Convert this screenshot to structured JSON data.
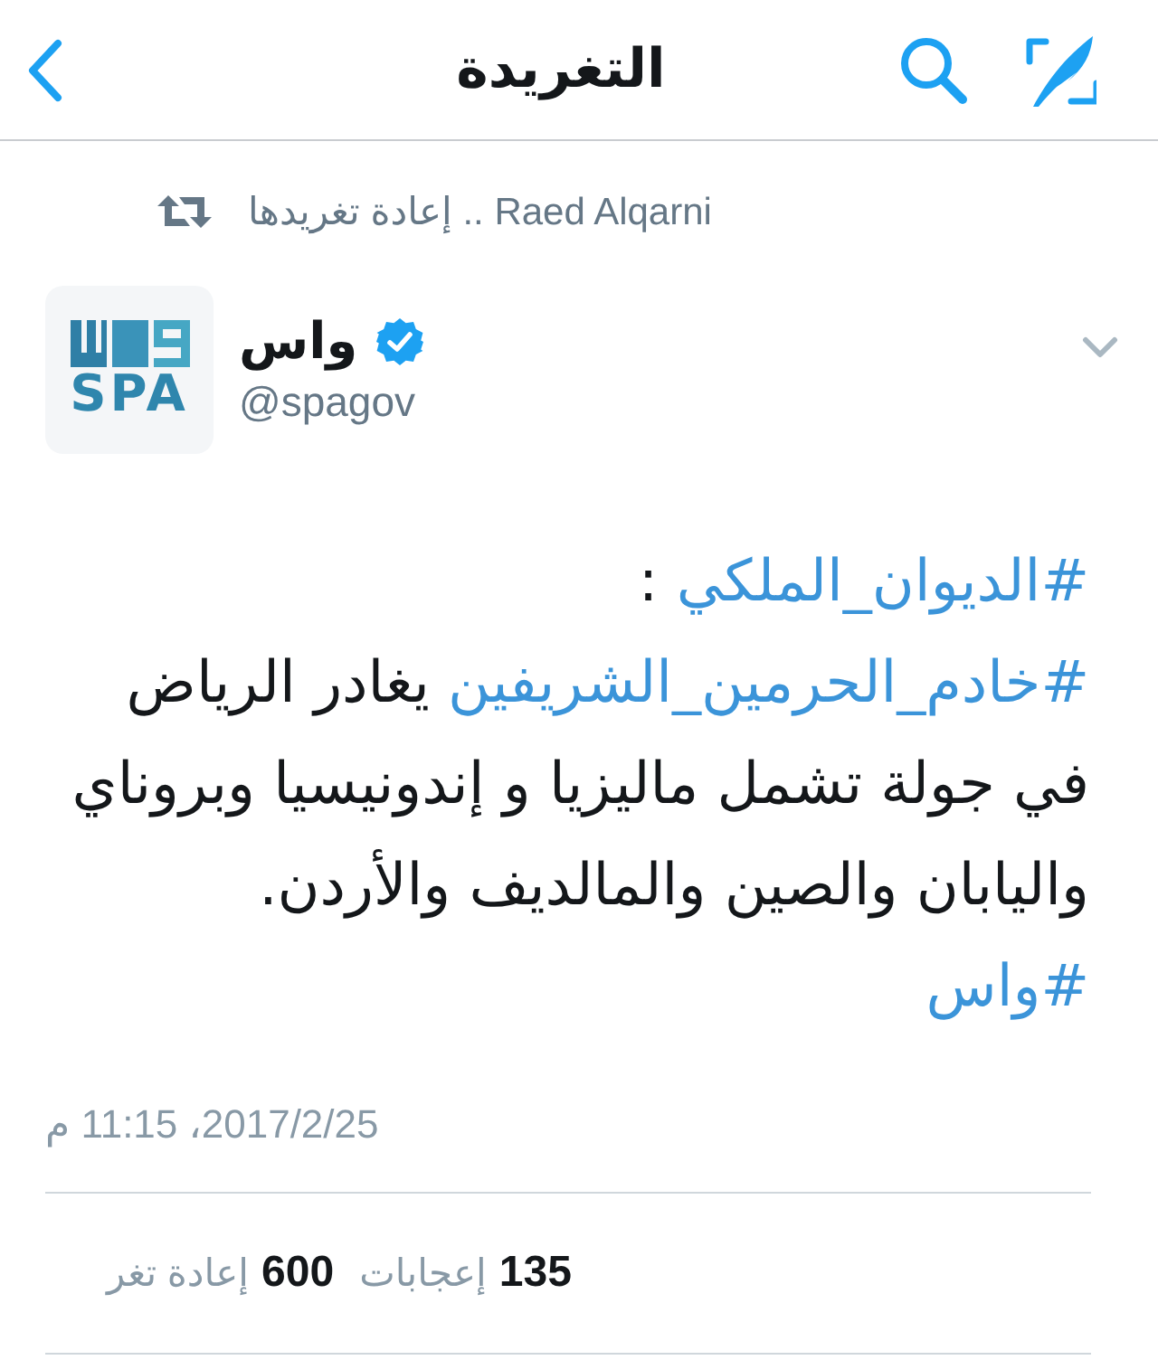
{
  "header": {
    "title": "التغريدة"
  },
  "retweet_context": {
    "text": "Raed Alqarni .. إعادة تغريدها"
  },
  "tweet": {
    "author": {
      "name": "واس",
      "verified": true,
      "handle": "@spagov",
      "avatar": {
        "logo_text": "SPA"
      }
    },
    "lines": [
      [
        {
          "kind": "hashtag",
          "text": "#الديوان_الملكي"
        },
        {
          "kind": "text",
          "text": " :"
        }
      ],
      [
        {
          "kind": "hashtag",
          "text": "#خادم_الحرمين_الشريفين"
        },
        {
          "kind": "text",
          "text": " يغادر الرياض"
        }
      ],
      [
        {
          "kind": "text",
          "text": "في جولة تشمل ماليزيا و إندونيسيا وبروناي"
        }
      ],
      [
        {
          "kind": "text",
          "text": "واليابان والصين والمالديف والأردن."
        }
      ],
      [
        {
          "kind": "hashtag",
          "text": "#واس"
        }
      ]
    ],
    "timestamp": "2017/2/25، 11:15 م",
    "stats": [
      {
        "count": "135",
        "label": "إعجابات"
      },
      {
        "count": "600",
        "label": "إعادة تغر"
      }
    ]
  }
}
